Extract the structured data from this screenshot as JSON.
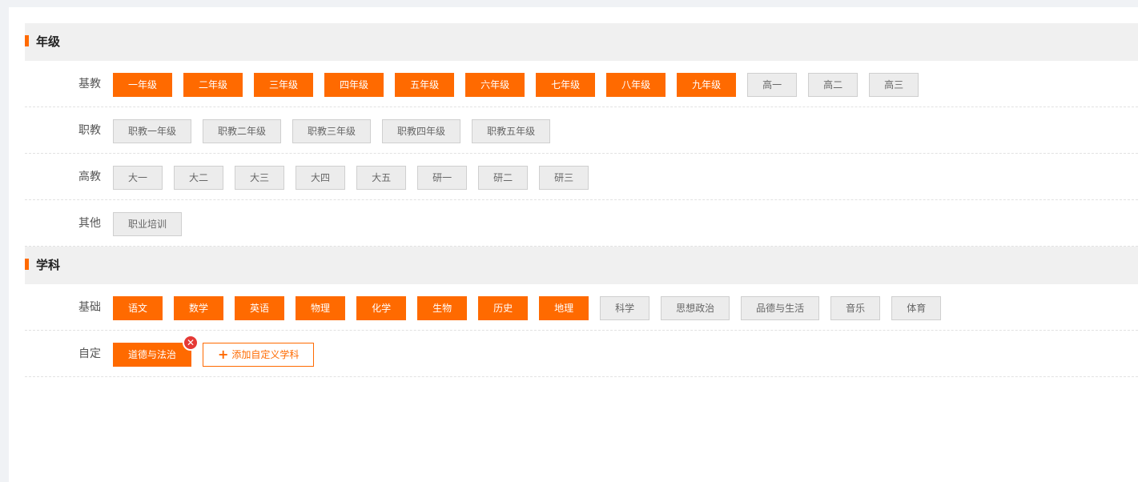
{
  "colors": {
    "accent": "#ff6a00",
    "inactive_bg": "#ececec",
    "remove": "#e53935"
  },
  "grade": {
    "title": "年级",
    "rows": [
      {
        "label": "基教",
        "items": [
          {
            "label": "一年级",
            "active": true
          },
          {
            "label": "二年级",
            "active": true
          },
          {
            "label": "三年级",
            "active": true
          },
          {
            "label": "四年级",
            "active": true
          },
          {
            "label": "五年级",
            "active": true
          },
          {
            "label": "六年级",
            "active": true
          },
          {
            "label": "七年级",
            "active": true
          },
          {
            "label": "八年级",
            "active": true
          },
          {
            "label": "九年级",
            "active": true
          },
          {
            "label": "高一",
            "active": false
          },
          {
            "label": "高二",
            "active": false
          },
          {
            "label": "高三",
            "active": false
          }
        ]
      },
      {
        "label": "职教",
        "items": [
          {
            "label": "职教一年级",
            "active": false
          },
          {
            "label": "职教二年级",
            "active": false
          },
          {
            "label": "职教三年级",
            "active": false
          },
          {
            "label": "职教四年级",
            "active": false
          },
          {
            "label": "职教五年级",
            "active": false
          }
        ]
      },
      {
        "label": "高教",
        "items": [
          {
            "label": "大一",
            "active": false
          },
          {
            "label": "大二",
            "active": false
          },
          {
            "label": "大三",
            "active": false
          },
          {
            "label": "大四",
            "active": false
          },
          {
            "label": "大五",
            "active": false
          },
          {
            "label": "研一",
            "active": false
          },
          {
            "label": "研二",
            "active": false
          },
          {
            "label": "研三",
            "active": false
          }
        ]
      },
      {
        "label": "其他",
        "items": [
          {
            "label": "职业培训",
            "active": false
          }
        ]
      }
    ]
  },
  "subject": {
    "title": "学科",
    "rows": [
      {
        "label": "基础",
        "items": [
          {
            "label": "语文",
            "active": true
          },
          {
            "label": "数学",
            "active": true
          },
          {
            "label": "英语",
            "active": true
          },
          {
            "label": "物理",
            "active": true
          },
          {
            "label": "化学",
            "active": true
          },
          {
            "label": "生物",
            "active": true
          },
          {
            "label": "历史",
            "active": true
          },
          {
            "label": "地理",
            "active": true
          },
          {
            "label": "科学",
            "active": false
          },
          {
            "label": "思想政治",
            "active": false
          },
          {
            "label": "品德与生活",
            "active": false
          },
          {
            "label": "音乐",
            "active": false
          },
          {
            "label": "体育",
            "active": false
          }
        ]
      },
      {
        "label": "自定",
        "items": [
          {
            "label": "道德与法治",
            "active": true,
            "removable": true
          }
        ],
        "add_label": "添加自定义学科",
        "add_icon": "plus-icon"
      }
    ]
  }
}
